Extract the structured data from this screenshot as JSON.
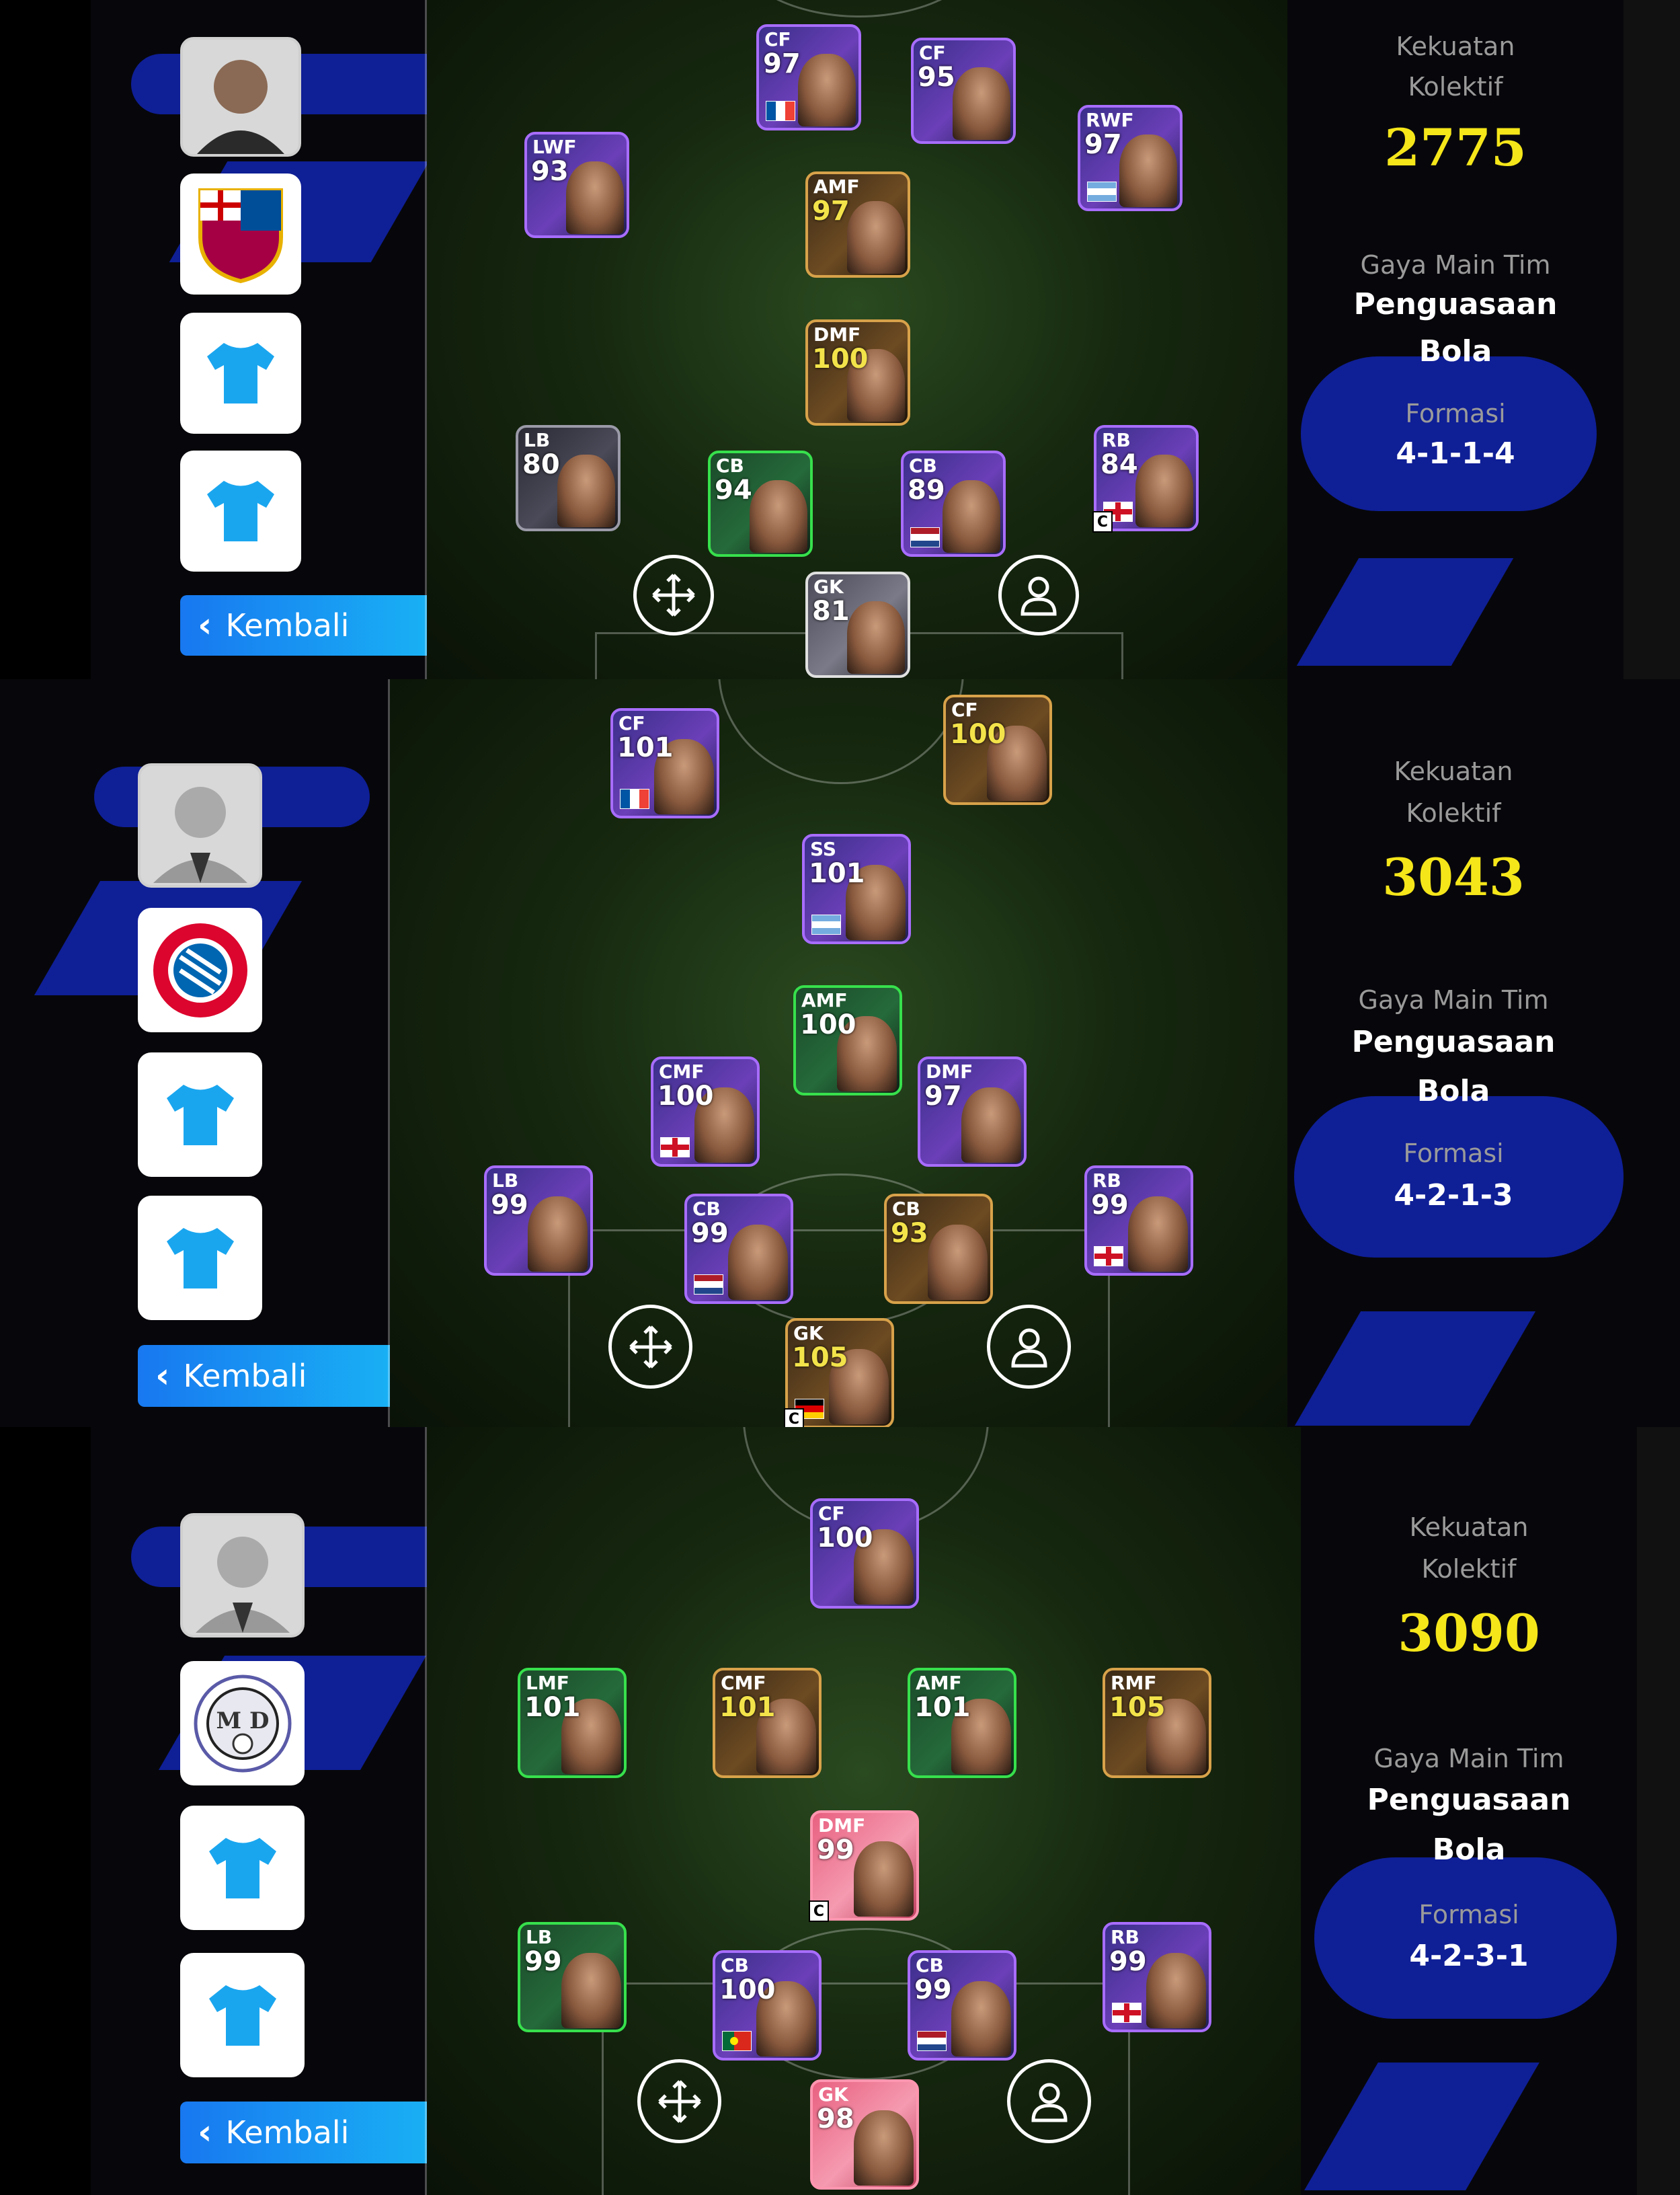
{
  "common": {
    "back_label": "Kembali",
    "strength_label_1": "Kekuatan",
    "strength_label_2": "Kolektif",
    "style_label": "Gaya Main Tim",
    "style_value_1": "Penguasaan",
    "style_value_2": "Bola",
    "formation_label": "Formasi",
    "captain_mark": "C"
  },
  "colors": {
    "accent_blue": "#1878f0",
    "strength_yellow": "#f5e61a",
    "deco_navy": "#0f1f96"
  },
  "panels": [
    {
      "team_logo": "fc-barcelona-crest",
      "strength": "2775",
      "formation": "4-1-1-4",
      "players": [
        {
          "pos": "CF",
          "ovr": "97",
          "flag": "france"
        },
        {
          "pos": "CF",
          "ovr": "95",
          "flag": "none"
        },
        {
          "pos": "LWF",
          "ovr": "93",
          "flag": "none"
        },
        {
          "pos": "AMF",
          "ovr": "97",
          "flag": "none"
        },
        {
          "pos": "RWF",
          "ovr": "97",
          "flag": "argentina"
        },
        {
          "pos": "DMF",
          "ovr": "100",
          "flag": "none"
        },
        {
          "pos": "LB",
          "ovr": "80",
          "flag": "none"
        },
        {
          "pos": "CB",
          "ovr": "94",
          "flag": "none"
        },
        {
          "pos": "CB",
          "ovr": "89",
          "flag": "netherlands"
        },
        {
          "pos": "RB",
          "ovr": "84",
          "flag": "england"
        },
        {
          "pos": "GK",
          "ovr": "81",
          "flag": "none"
        }
      ]
    },
    {
      "team_logo": "fc-bayern-munchen-crest",
      "strength": "3043",
      "formation": "4-2-1-3",
      "players": [
        {
          "pos": "CF",
          "ovr": "101",
          "flag": "france"
        },
        {
          "pos": "CF",
          "ovr": "100",
          "flag": "none"
        },
        {
          "pos": "SS",
          "ovr": "101",
          "flag": "argentina"
        },
        {
          "pos": "AMF",
          "ovr": "100",
          "flag": "none"
        },
        {
          "pos": "CMF",
          "ovr": "100",
          "flag": "england"
        },
        {
          "pos": "DMF",
          "ovr": "97",
          "flag": "none"
        },
        {
          "pos": "LB",
          "ovr": "99",
          "flag": "none"
        },
        {
          "pos": "CB",
          "ovr": "99",
          "flag": "netherlands"
        },
        {
          "pos": "CB",
          "ovr": "93",
          "flag": "none"
        },
        {
          "pos": "RB",
          "ovr": "99",
          "flag": "england"
        },
        {
          "pos": "GK",
          "ovr": "105",
          "flag": "germany"
        }
      ]
    },
    {
      "team_logo": "club-md-crest",
      "strength": "3090",
      "formation": "4-2-3-1",
      "players": [
        {
          "pos": "CF",
          "ovr": "100",
          "flag": "none"
        },
        {
          "pos": "LMF",
          "ovr": "101",
          "flag": "none"
        },
        {
          "pos": "CMF",
          "ovr": "101",
          "flag": "none"
        },
        {
          "pos": "AMF",
          "ovr": "101",
          "flag": "none"
        },
        {
          "pos": "RMF",
          "ovr": "105",
          "flag": "none"
        },
        {
          "pos": "DMF",
          "ovr": "99",
          "flag": "none"
        },
        {
          "pos": "LB",
          "ovr": "99",
          "flag": "none"
        },
        {
          "pos": "CB",
          "ovr": "100",
          "flag": "portugal"
        },
        {
          "pos": "CB",
          "ovr": "99",
          "flag": "netherlands"
        },
        {
          "pos": "RB",
          "ovr": "99",
          "flag": "england"
        },
        {
          "pos": "GK",
          "ovr": "98",
          "flag": "none"
        }
      ]
    }
  ]
}
